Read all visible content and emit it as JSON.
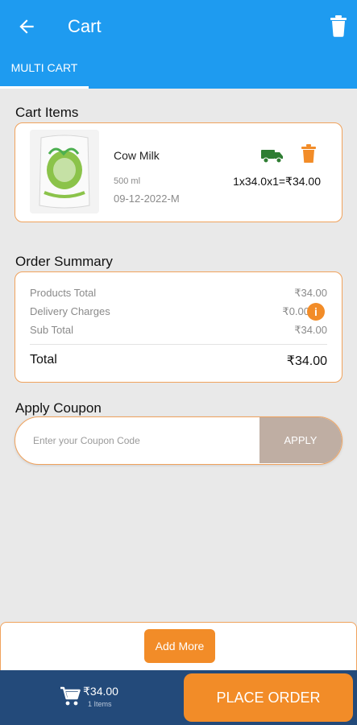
{
  "header": {
    "title": "Cart",
    "tab_label": "MULTI CART",
    "back_icon": "arrow-left-icon",
    "trash_icon": "trash-icon"
  },
  "cart_items": {
    "section_title": "Cart Items",
    "items": [
      {
        "name": "Cow Milk",
        "size": "500 ml",
        "date": "09-12-2022-M",
        "price_calc": "1x34.0x1=₹34.00"
      }
    ]
  },
  "order_summary": {
    "section_title": "Order Summary",
    "products_total_label": "Products Total",
    "products_total_value": "₹34.00",
    "delivery_label": "Delivery Charges",
    "delivery_value": "₹0.00",
    "sub_total_label": "Sub Total",
    "sub_total_value": "₹34.00",
    "total_label": "Total",
    "total_value": "₹34.00",
    "info_symbol": "i"
  },
  "coupon": {
    "section_title": "Apply Coupon",
    "placeholder": "Enter your Coupon Code",
    "value": "",
    "apply_label": "APPLY"
  },
  "bottom": {
    "add_more_label": "Add More",
    "amount": "₹34.00",
    "items_count": "1 Items",
    "place_order_label": "PLACE ORDER"
  },
  "colors": {
    "header_blue": "#1e9bf0",
    "accent_orange": "#f28c28",
    "bottom_bar": "#234a7a",
    "truck_green": "#2e7d32"
  }
}
